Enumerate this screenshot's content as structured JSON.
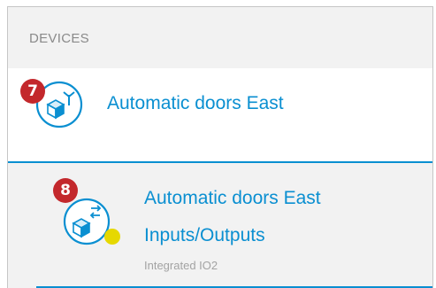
{
  "panel": {
    "title": "DEVICES"
  },
  "device": {
    "label": "Automatic doors East",
    "badge": "7",
    "icon": "wireless-device-icon"
  },
  "sub_device": {
    "label_line1": "Automatic doors East",
    "label_line2": "Inputs/Outputs",
    "caption": "Integrated IO2",
    "badge": "8",
    "icon": "io-module-icon",
    "status_color": "#e6d800"
  },
  "colors": {
    "accent": "#0a8fd1",
    "badge": "#c3282c"
  }
}
